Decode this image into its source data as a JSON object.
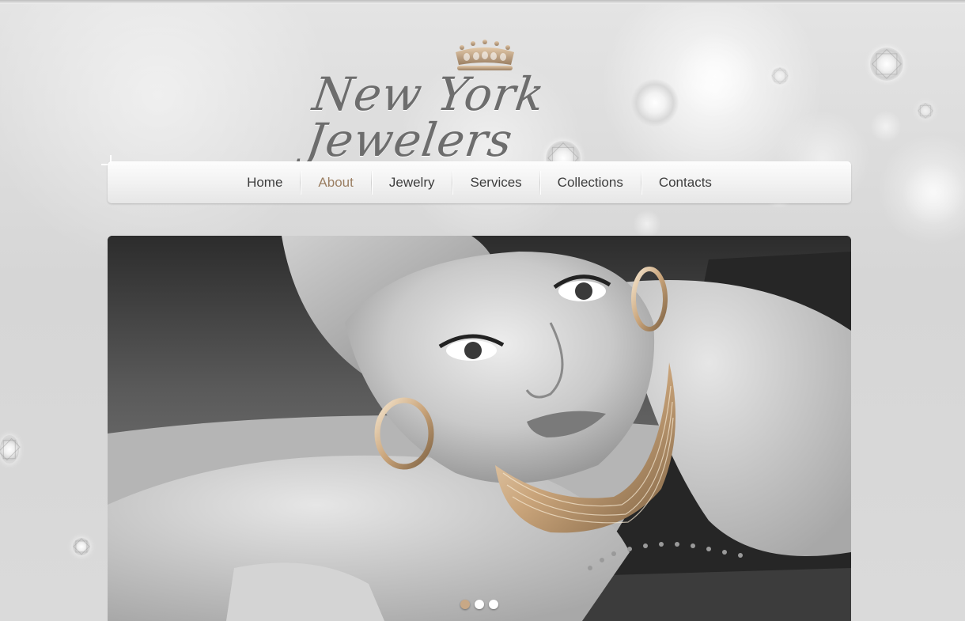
{
  "brand": {
    "name": "New York Jewelers",
    "accent_color": "#9b7f63",
    "crown_icon": "crown-icon"
  },
  "nav": {
    "items": [
      {
        "label": "Home",
        "active": false
      },
      {
        "label": "About",
        "active": true
      },
      {
        "label": "Jewelry",
        "active": false
      },
      {
        "label": "Services",
        "active": false
      },
      {
        "label": "Collections",
        "active": false
      },
      {
        "label": "Contacts",
        "active": false
      }
    ]
  },
  "slider": {
    "image": "woman-with-gold-jewelry-photo",
    "slides": 3,
    "active_slide": 1
  }
}
